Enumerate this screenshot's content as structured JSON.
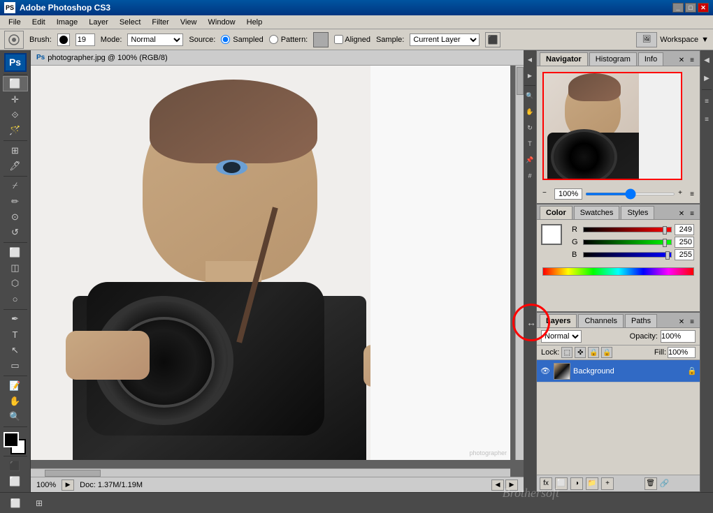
{
  "titlebar": {
    "title": "Adobe Photoshop CS3",
    "icon": "PS"
  },
  "menubar": {
    "items": [
      "File",
      "Edit",
      "Image",
      "Layer",
      "Select",
      "Filter",
      "View",
      "Window",
      "Help"
    ]
  },
  "optionsbar": {
    "brush_label": "Brush:",
    "brush_size": "19",
    "mode_label": "Mode:",
    "mode_value": "Normal",
    "source_label": "Source:",
    "sampled_label": "Sampled",
    "pattern_label": "Pattern:",
    "aligned_label": "Aligned",
    "sample_label": "Sample:",
    "sample_value": "Current Layer",
    "workspace_label": "Workspace"
  },
  "canvas": {
    "title": "photographer.jpg @ 100% (RGB/8)",
    "zoom": "100%",
    "doc_info": "Doc: 1.37M/1.19M"
  },
  "navigator": {
    "panel_label": "Navigator",
    "histogram_label": "Histogram",
    "info_label": "Info",
    "zoom_value": "100%"
  },
  "color_panel": {
    "panel_label": "Color",
    "swatches_label": "Swatches",
    "styles_label": "Styles",
    "r_label": "R",
    "g_label": "G",
    "b_label": "B",
    "r_value": "249",
    "g_value": "250",
    "b_value": "255"
  },
  "layers_panel": {
    "layers_label": "Layers",
    "channels_label": "Channels",
    "paths_label": "Paths",
    "blend_mode": "Normal",
    "opacity_label": "Opacity:",
    "opacity_value": "100%",
    "lock_label": "Lock:",
    "fill_label": "Fill:",
    "fill_value": "100%",
    "layer_name": "Background"
  },
  "tools": {
    "left": [
      "▣",
      "⊕",
      "⟐",
      "✂",
      "✒",
      "⌫",
      "⬜",
      "◯",
      "⬡",
      "🖌",
      "✏",
      "⌫",
      "🪣",
      "⚙",
      "◈",
      "🔍",
      "✋",
      "🖱",
      "🔧",
      "◩",
      "☷",
      "⬛",
      "🔲",
      "📐"
    ]
  },
  "watermark": "Brothersoft"
}
